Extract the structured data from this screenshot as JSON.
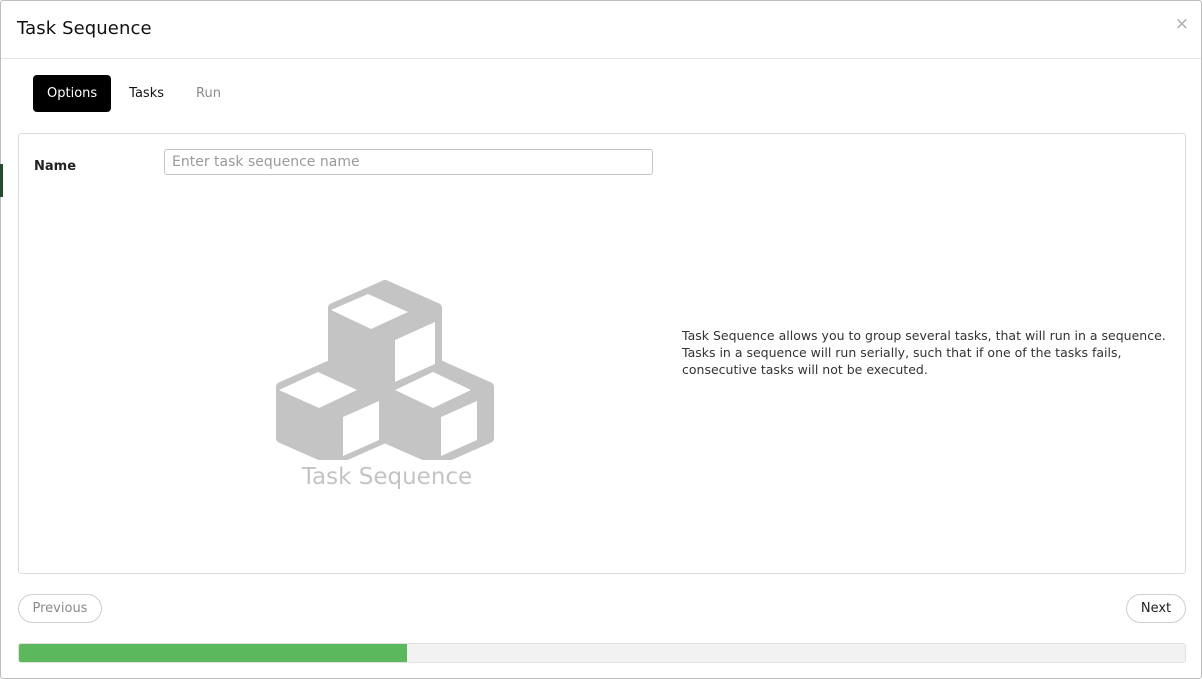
{
  "modal": {
    "title": "Task Sequence",
    "close_label": "×"
  },
  "tabs": [
    {
      "label": "Options",
      "state": "active"
    },
    {
      "label": "Tasks",
      "state": "normal"
    },
    {
      "label": "Run",
      "state": "disabled"
    }
  ],
  "form": {
    "name_label": "Name",
    "name_value": "",
    "name_placeholder": "Enter task sequence name"
  },
  "illustration": {
    "icon": "cubes-icon",
    "caption": "Task Sequence",
    "color": "#c4c4c4"
  },
  "description": "Task Sequence allows you to group several tasks, that will run in a sequence. Tasks in a sequence will run serially, such that if one of the tasks fails, consecutive tasks will not be executed.",
  "footer": {
    "previous_label": "Previous",
    "next_label": "Next"
  },
  "progress": {
    "value_percent": 33.3,
    "color": "#5cb85c"
  }
}
